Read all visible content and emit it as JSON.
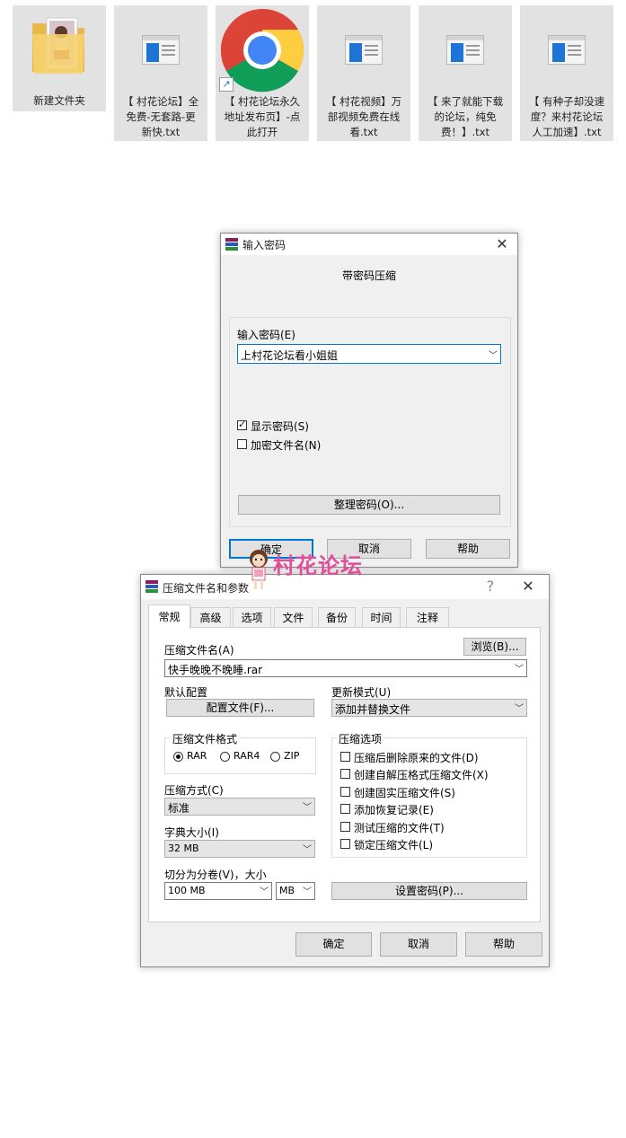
{
  "desktop": {
    "files": [
      {
        "label": "新建文件夹",
        "icon": "folder-icon"
      },
      {
        "label": "【 村花论坛】全免费-无套路-更新快.txt",
        "icon": "text-file-icon"
      },
      {
        "label": "【 村花论坛永久地址发布页】-点此打开",
        "icon": "chrome-icon"
      },
      {
        "label": "【 村花视频】万部视频免费在线看.txt",
        "icon": "text-file-icon"
      },
      {
        "label": "【 来了就能下载的论坛，纯免费！】.txt",
        "icon": "text-file-icon"
      },
      {
        "label": "【 有种子却没速度？来村花论坛人工加速】.txt",
        "icon": "text-file-icon"
      }
    ],
    "file_lines": [
      [
        "新建文件夹"
      ],
      [
        "【 村花论坛】全",
        "免费-无套路-更",
        "新快.txt"
      ],
      [
        "【 村花论坛永久",
        "地址发布页】-点",
        "此打开"
      ],
      [
        "【 村花视频】万",
        "部视频免费在线",
        "看.txt"
      ],
      [
        "【 来了就能下载",
        "的论坛，纯免",
        "费！】.txt"
      ],
      [
        "【 有种子却没速",
        "度？来村花论坛",
        "人工加速】.txt"
      ]
    ]
  },
  "password_dialog": {
    "title": "输入密码",
    "heading": "带密码压缩",
    "field_label": "输入密码(E)",
    "password_value": "上村花论坛看小姐姐",
    "show_password_label": "显示密码(S)",
    "show_password_checked": true,
    "encrypt_names_label": "加密文件名(N)",
    "encrypt_names_checked": false,
    "organize_button": "整理密码(O)...",
    "ok_button": "确定",
    "cancel_button": "取消",
    "help_button": "帮助"
  },
  "watermark": {
    "text": "村花论坛",
    "color": "#e0509a"
  },
  "archive_dialog": {
    "title": "压缩文件名和参数",
    "help_glyph": "?",
    "tabs": [
      "常规",
      "高级",
      "选项",
      "文件",
      "备份",
      "时间",
      "注释"
    ],
    "active_tab": "常规",
    "archive_name_label": "压缩文件名(A)",
    "browse_button": "浏览(B)...",
    "archive_name_value": "快手晚晚不晚睡.rar",
    "default_profile_label": "默认配置",
    "profiles_button": "配置文件(F)...",
    "update_mode_label": "更新模式(U)",
    "update_mode_value": "添加并替换文件",
    "format_group_label": "压缩文件格式",
    "formats": [
      "RAR",
      "RAR4",
      "ZIP"
    ],
    "selected_format": "RAR",
    "options_group_label": "压缩选项",
    "options": [
      {
        "label": "压缩后删除原来的文件(D)",
        "checked": false
      },
      {
        "label": "创建自解压格式压缩文件(X)",
        "checked": false
      },
      {
        "label": "创建固实压缩文件(S)",
        "checked": false
      },
      {
        "label": "添加恢复记录(E)",
        "checked": false
      },
      {
        "label": "测试压缩的文件(T)",
        "checked": false
      },
      {
        "label": "锁定压缩文件(L)",
        "checked": false
      }
    ],
    "method_label": "压缩方式(C)",
    "method_value": "标准",
    "dict_label": "字典大小(I)",
    "dict_value": "32 MB",
    "split_label": "切分为分卷(V)，大小",
    "split_value": "100 MB",
    "split_unit": "MB",
    "set_password_button": "设置密码(P)...",
    "ok_button": "确定",
    "cancel_button": "取消",
    "help_button": "帮助"
  },
  "colors": {
    "accent_blue": "#1e73d6",
    "focus_border": "#0078d7",
    "dialog_bg": "#f0f0f0"
  }
}
